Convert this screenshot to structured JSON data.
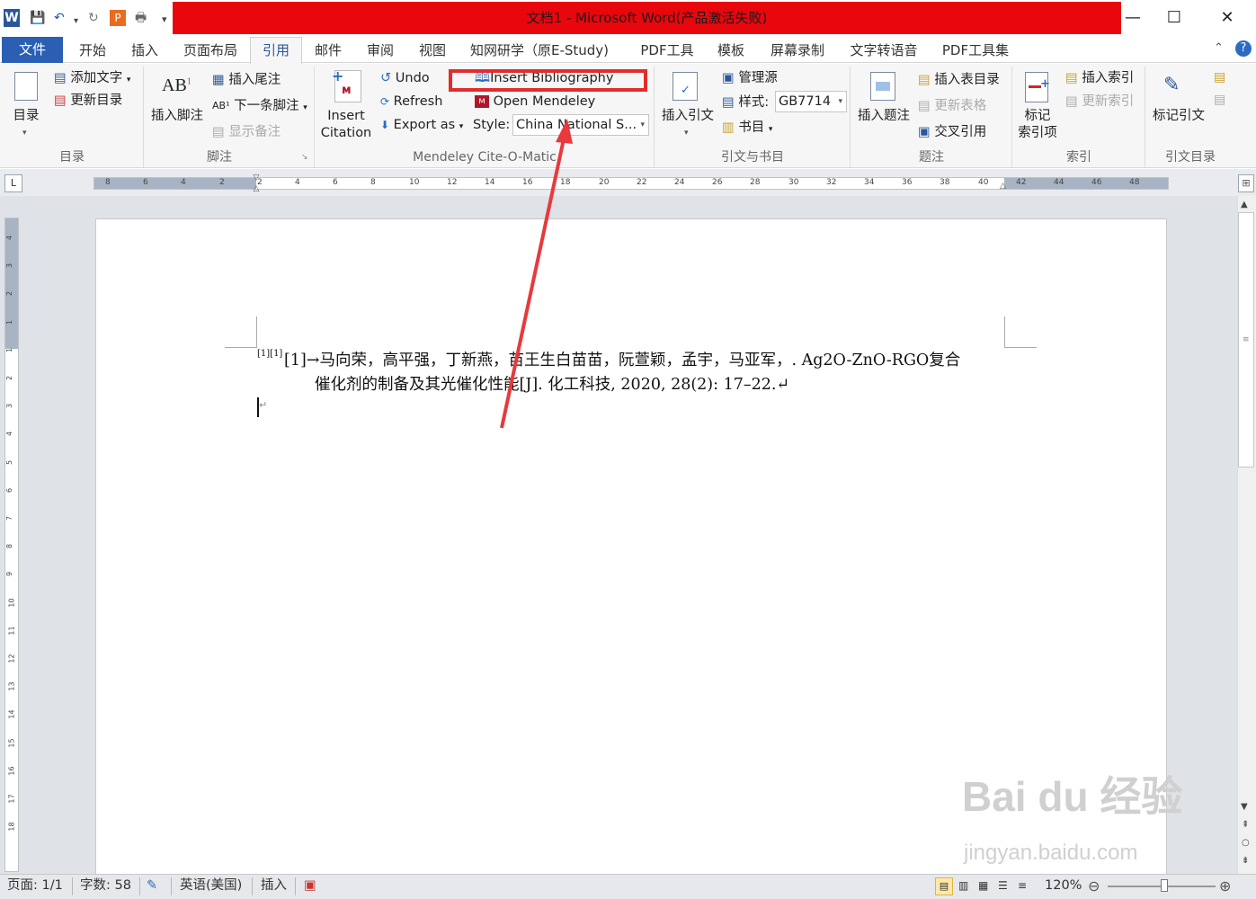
{
  "window": {
    "title": "文档1 - Microsoft Word(产品激活失败)",
    "minimize": "—",
    "maximize": "☐",
    "close": "✕"
  },
  "tabs": {
    "file": "文件",
    "items": [
      "开始",
      "插入",
      "页面布局",
      "引用",
      "邮件",
      "审阅",
      "视图",
      "知网研学（原E-Study)",
      "PDF工具",
      "模板",
      "屏幕录制",
      "文字转语音",
      "PDF工具集"
    ],
    "active": "引用"
  },
  "ribbon": {
    "toc": {
      "big": "目录",
      "add_text": "添加文字",
      "update_toc": "更新目录",
      "group": "目录"
    },
    "footnote": {
      "insert_footnote": "插入脚注",
      "insert_endnote": "插入尾注",
      "next_footnote": "下一条脚注",
      "show_notes": "显示备注",
      "group": "脚注"
    },
    "mendeley": {
      "insert_citation": "Insert Citation",
      "insert_citation_l1": "Insert",
      "insert_citation_l2": "Citation",
      "undo": "Undo",
      "refresh": "Refresh",
      "export_as": "Export as",
      "insert_bibliography": "Insert Bibliography",
      "open_mendeley": "Open Mendeley",
      "style_label": "Style:",
      "style_value": "China National S...",
      "group": "Mendeley Cite-O-Matic"
    },
    "citations": {
      "insert_citation": "插入引文",
      "manage_sources": "管理源",
      "style_label": "样式:",
      "style_value": "GB7714",
      "bibliography": "书目",
      "group": "引文与书目"
    },
    "captions": {
      "insert_caption": "插入题注",
      "insert_table_of_figures": "插入表目录",
      "update_table": "更新表格",
      "cross_reference": "交叉引用",
      "group": "题注"
    },
    "index": {
      "mark_entry_l1": "标记",
      "mark_entry_l2": "索引项",
      "insert_index": "插入索引",
      "update_index": "更新索引",
      "group": "索引"
    },
    "toa": {
      "mark_citation": "标记引文",
      "group": "引文目录"
    }
  },
  "ruler": {
    "h_ticks": [
      "8",
      "6",
      "4",
      "2",
      "2",
      "4",
      "6",
      "8",
      "10",
      "12",
      "14",
      "16",
      "18",
      "20",
      "22",
      "24",
      "26",
      "28",
      "30",
      "32",
      "34",
      "36",
      "38",
      "40",
      "42",
      "44",
      "46",
      "48"
    ],
    "v_ticks": [
      "4",
      "3",
      "2",
      "1",
      "1",
      "2",
      "3",
      "4",
      "5",
      "6",
      "7",
      "8",
      "9",
      "10",
      "11",
      "12",
      "13",
      "14",
      "15",
      "16",
      "17",
      "18"
    ]
  },
  "document": {
    "superscript": "[1][1]",
    "line1": "[1]→马向荣，高平强，丁新燕，苗王生白苗苗，阮萱颖，孟宇，马亚军，. Ag2O-ZnO-RGO复合",
    "line2": "催化剂的制备及其光催化性能[J]. 化工科技, 2020, 28(2): 17–22.↵",
    "cursor_mark": "↵"
  },
  "status": {
    "page": "页面: 1/1",
    "words": "字数: 58",
    "language": "英语(美国)",
    "mode": "插入",
    "zoom": "120%"
  },
  "watermark": {
    "brand": "Bai du 经验",
    "url": "jingyan.baidu.com"
  },
  "colors": {
    "title_bar_red": "#e8070d",
    "file_tab": "#2a5fb4",
    "highlight_box": "#e22c2c",
    "arrow": "#e8393c"
  }
}
